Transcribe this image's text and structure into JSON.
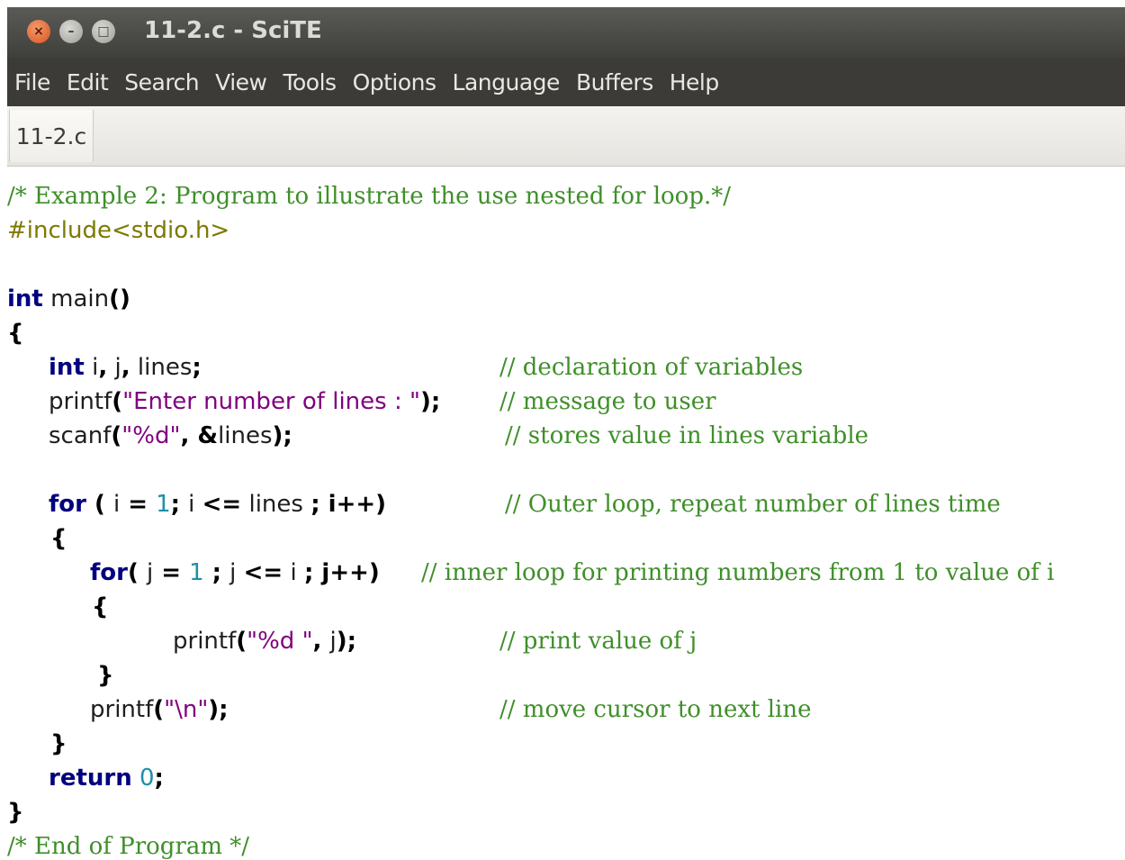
{
  "window": {
    "title": "11-2.c - SciTE",
    "buttons": {
      "close": "×",
      "minimize": "–",
      "maximize": "□"
    }
  },
  "menu": [
    "File",
    "Edit",
    "Search",
    "View",
    "Tools",
    "Options",
    "Language",
    "Buffers",
    "Help"
  ],
  "tabs": [
    {
      "label": "11-2.c"
    }
  ],
  "code": {
    "l1": "/* Example 2: Program to illustrate the use nested for loop.*/",
    "l2": "#include<stdio.h>",
    "l4_kw": "int",
    "l4_rest": " main",
    "l4_paren": "()",
    "l5": "{",
    "l6_kw": "int",
    "l6_a": " i",
    "l6_c1": ",",
    "l6_b": " j",
    "l6_c2": ",",
    "l6_c": " lines",
    "l6_semi": ";",
    "l6_cmt": "// declaration of variables",
    "l7_fn": "printf",
    "l7_p1": "(",
    "l7_str": "\"Enter number of lines : \"",
    "l7_end": ");",
    "l7_cmt": "// message to user",
    "l8_fn": "scanf",
    "l8_p1": "(",
    "l8_str": "\"%d\"",
    "l8_c": ", ",
    "l8_amp": "&",
    "l8_var": "lines",
    "l8_end": ");",
    "l8_cmt": "// stores value in lines variable",
    "l10_kw": "for",
    "l10_a": " ( ",
    "l10_i": "i",
    "l10_eq": " = ",
    "l10_num": "1",
    "l10_s1": "; ",
    "l10_i2": "i ",
    "l10_le": "<=",
    "l10_lines": " lines ",
    "l10_s2": "; ",
    "l10_ipp": "i++",
    "l10_close": ")",
    "l10_cmt": "// Outer loop, repeat number of lines time",
    "l11": "{",
    "l12_kw": "for",
    "l12_a": "( ",
    "l12_j": "j",
    "l12_eq": " = ",
    "l12_num": "1",
    "l12_s1": " ; ",
    "l12_j2": "j ",
    "l12_le": "<=",
    "l12_i": " i ",
    "l12_s2": "; ",
    "l12_jpp": "j++",
    "l12_close": ")",
    "l12_cmt": "// inner loop for printing numbers from 1 to value of i",
    "l13": "{",
    "l14_fn": "printf",
    "l14_p1": "(",
    "l14_str": "\"%d \"",
    "l14_c": ", ",
    "l14_j": "j",
    "l14_end": ");",
    "l14_cmt": "// print value of j",
    "l15": "}",
    "l16_fn": "printf",
    "l16_p1": "(",
    "l16_str": "\"\\n\"",
    "l16_end": ");",
    "l16_cmt": "// move cursor to next line",
    "l17": "}",
    "l18_kw": "return",
    "l18_sp": " ",
    "l18_num": "0",
    "l18_semi": ";",
    "l19": "}",
    "l20": "/* End of Program */"
  }
}
